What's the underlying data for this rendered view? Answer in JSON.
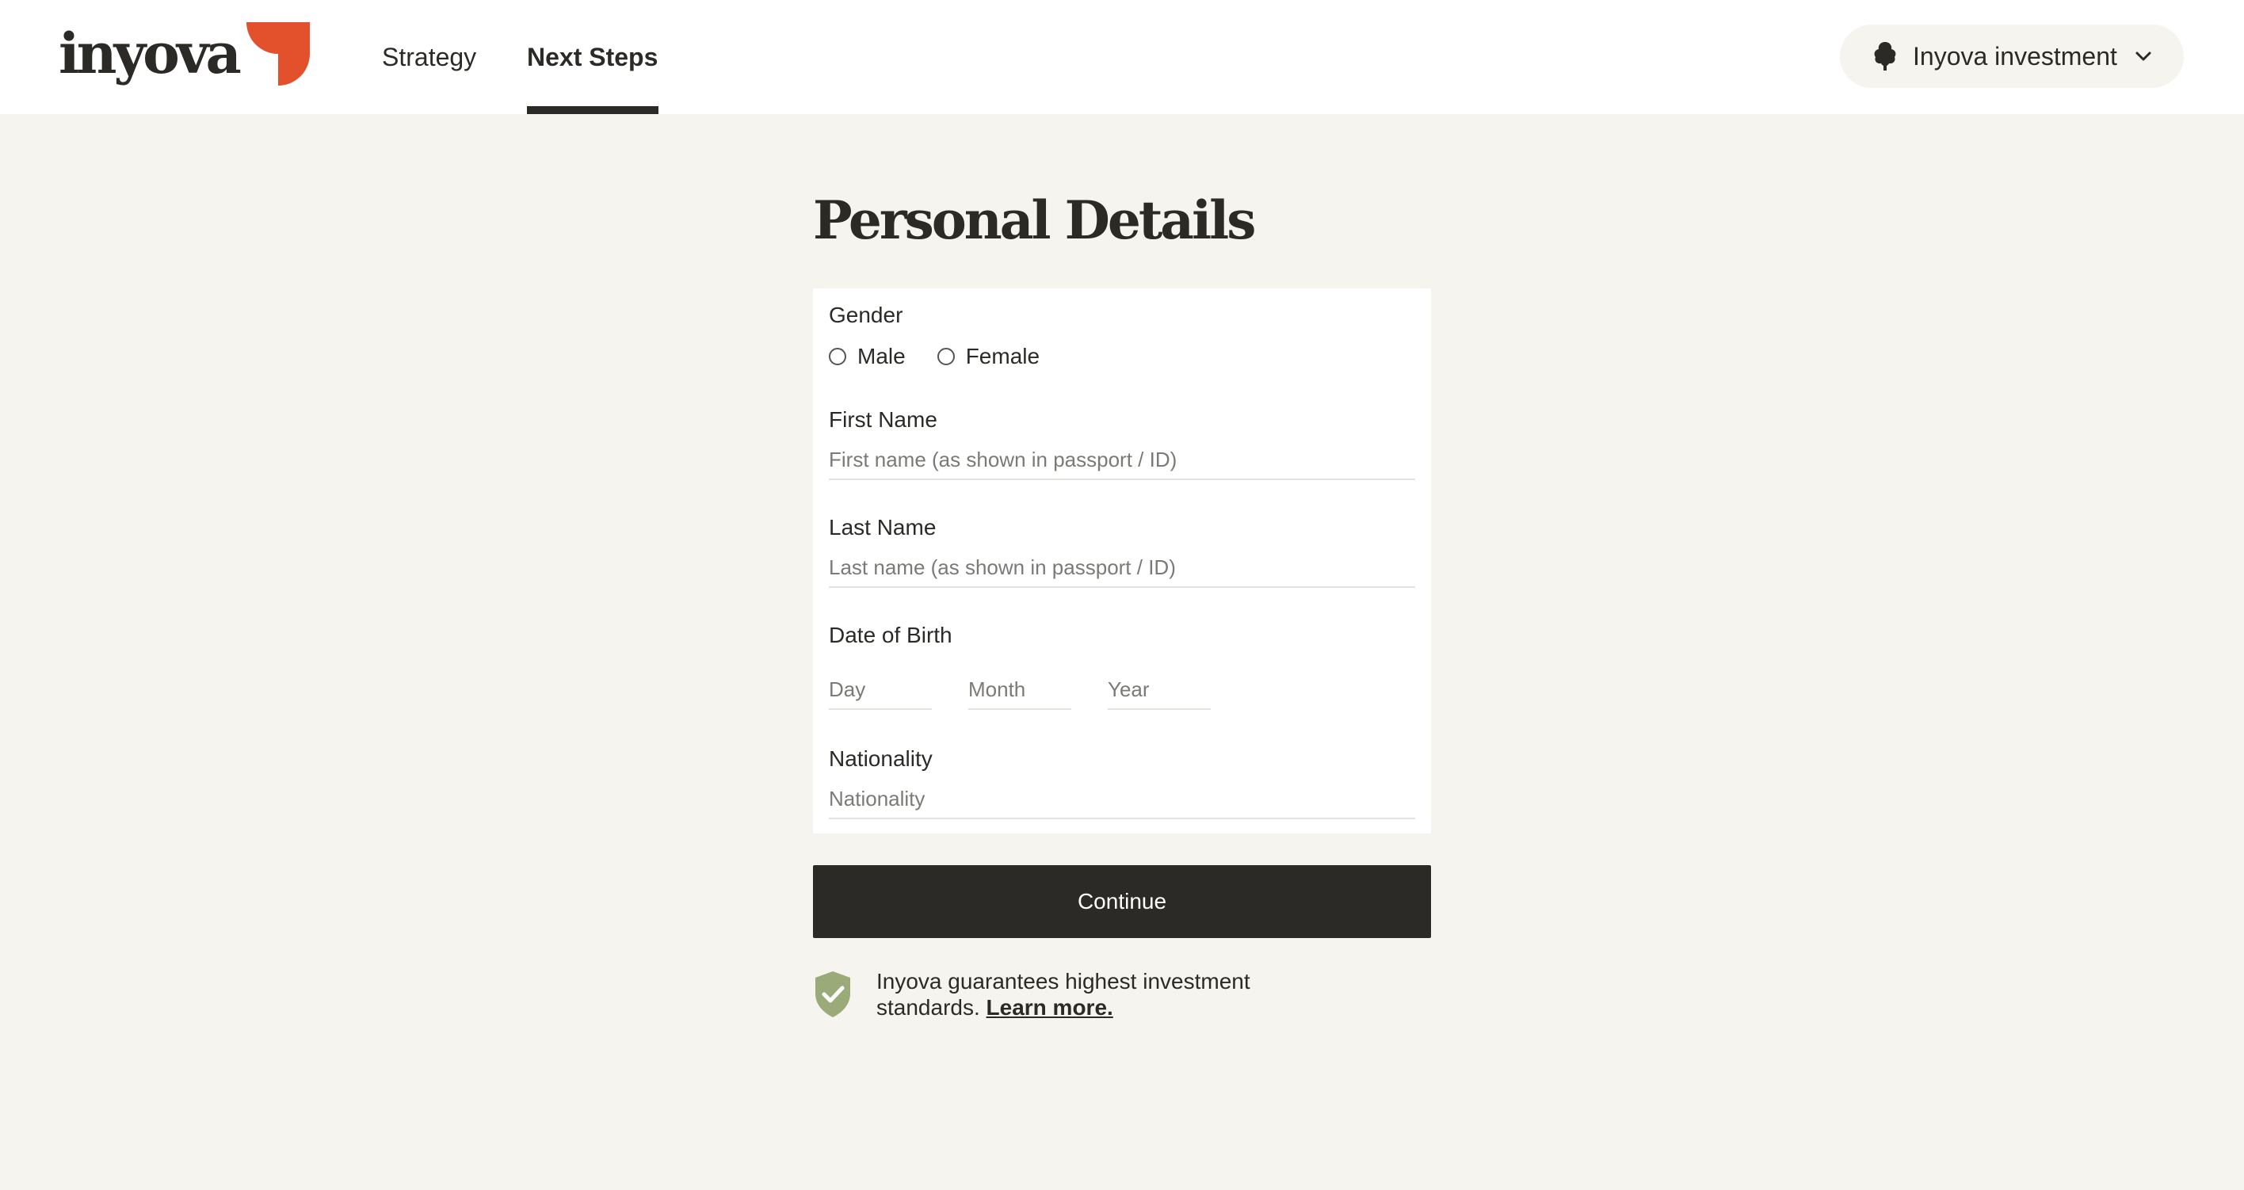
{
  "header": {
    "logo_text": "inyova",
    "nav": [
      {
        "label": "Strategy",
        "active": false
      },
      {
        "label": "Next Steps",
        "active": true
      }
    ],
    "account": {
      "label": "Inyova investment",
      "icon": "tree-icon",
      "chevron": "chevron-down-icon"
    }
  },
  "page": {
    "title": "Personal Details"
  },
  "form": {
    "gender": {
      "label": "Gender",
      "options": [
        "Male",
        "Female"
      ]
    },
    "first_name": {
      "label": "First Name",
      "placeholder": "First name (as shown in passport / ID)"
    },
    "last_name": {
      "label": "Last Name",
      "placeholder": "Last name (as shown in passport / ID)"
    },
    "dob": {
      "label": "Date of Birth",
      "day_placeholder": "Day",
      "month_placeholder": "Month",
      "year_placeholder": "Year"
    },
    "nationality": {
      "label": "Nationality",
      "placeholder": "Nationality"
    }
  },
  "actions": {
    "continue_label": "Continue"
  },
  "guarantee": {
    "text": "Inyova guarantees highest investment standards.",
    "link_label": "Learn more.",
    "icon": "shield-check-icon"
  },
  "colors": {
    "brand_orange": "#e2512b",
    "dark": "#2b2a26",
    "background": "#f5f4ef",
    "shield_green": "#9aab79"
  }
}
